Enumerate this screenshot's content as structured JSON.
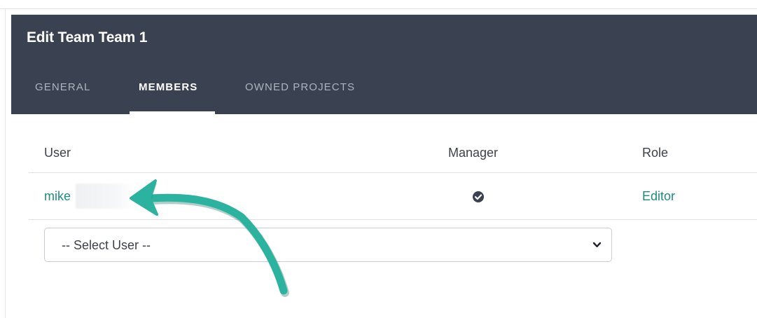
{
  "panel": {
    "title": "Edit Team Team 1",
    "tabs": [
      {
        "label": "GENERAL",
        "active": false
      },
      {
        "label": "MEMBERS",
        "active": true
      },
      {
        "label": "OWNED PROJECTS",
        "active": false
      }
    ]
  },
  "table": {
    "headers": {
      "user": "User",
      "manager": "Manager",
      "role": "Role"
    },
    "rows": [
      {
        "user": "mike",
        "manager_icon": "check-circle-icon",
        "role": "Editor"
      }
    ]
  },
  "select_user": {
    "value": "-- Select User --",
    "icon": "chevron-down-icon"
  },
  "annotation": {
    "icon": "arrow-annotation",
    "color": "#2bb3a0"
  },
  "colors": {
    "header_bg": "#3a4150",
    "link": "#1f8a82",
    "arrow": "#2bb3a0"
  }
}
